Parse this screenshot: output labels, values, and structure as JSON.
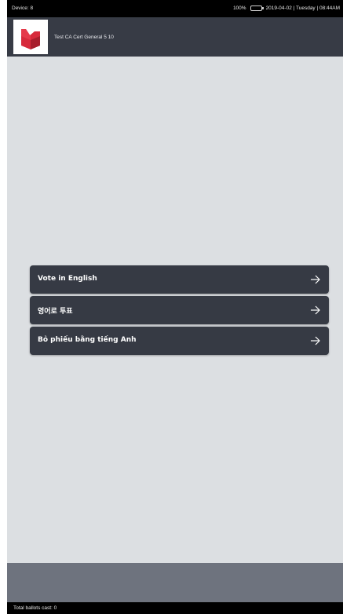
{
  "status": {
    "device": "Device: 8",
    "battery": "100%",
    "datetime": "2019-04-02 | Tuesday | 08:44AM"
  },
  "header": {
    "title": "Test CA Cert General 5 10"
  },
  "buttons": [
    {
      "label": "Vote in English"
    },
    {
      "label": "영어로 투표"
    },
    {
      "label": "Bỏ phiếu bằng tiếng Anh"
    }
  ],
  "footer": {
    "total_ballots": "Total ballots cast: 0"
  },
  "colors": {
    "header_bg": "#373b45",
    "button_bg": "#363a44",
    "logo_red": "#d72a3b",
    "page_bg": "#dcdfe2",
    "footer_band": "#6e737e"
  },
  "icons": {
    "logo": "ballot-box-logo-icon",
    "arrow": "arrow-right-icon",
    "battery": "battery-icon"
  }
}
